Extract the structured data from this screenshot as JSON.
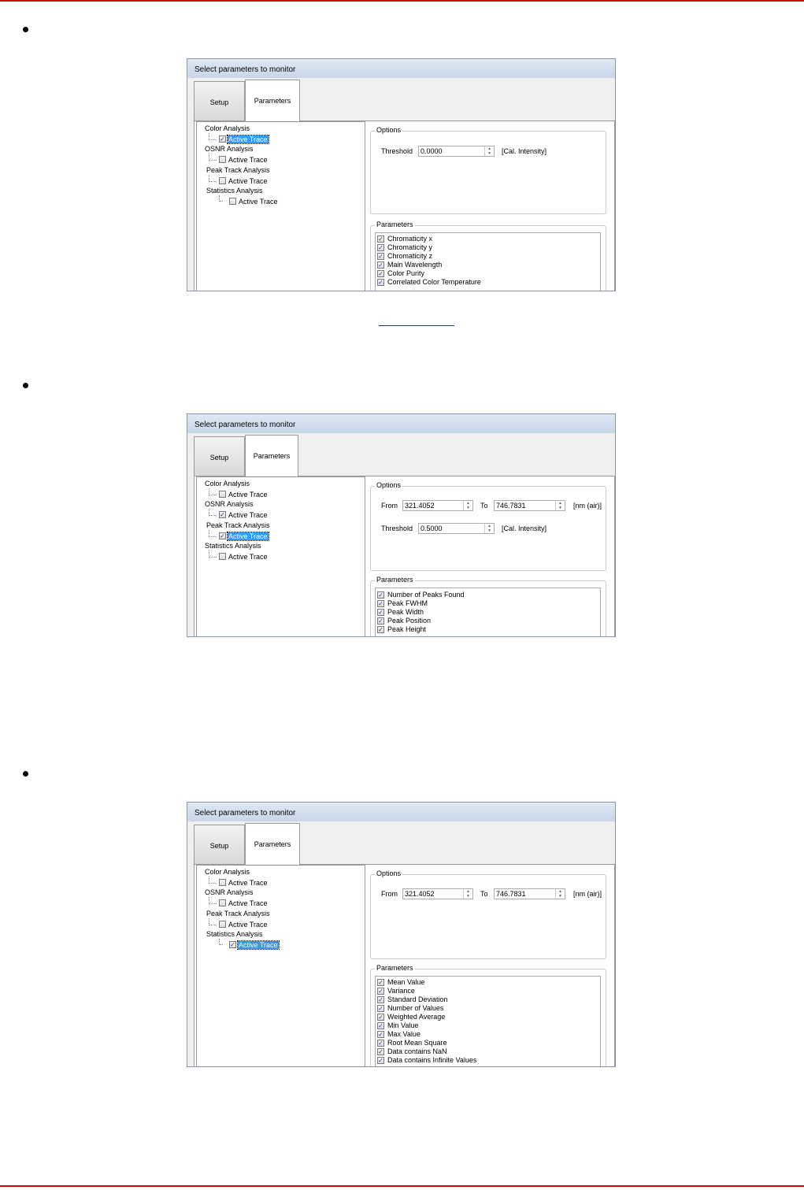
{
  "dialogs": [
    {
      "title": "Select parameters to monitor",
      "tabs": [
        "Setup",
        "Parameters"
      ],
      "tree": [
        {
          "label": "Color Analysis",
          "child": "Active Trace",
          "checked": true,
          "selected": true
        },
        {
          "label": "OSNR Analysis",
          "child": "Active Trace",
          "checked": false,
          "selected": false
        },
        {
          "label": "Peak Track Analysis",
          "child": "Active Trace",
          "checked": false,
          "selected": false
        },
        {
          "label": "Statistics Analysis",
          "child": "Active Trace",
          "checked": false,
          "selected": false
        }
      ],
      "options_title": "Options",
      "threshold": {
        "label": "Threshold",
        "value": "0.0000",
        "unit": "[Cal. Intensity]"
      },
      "parameters_title": "Parameters",
      "parameters": [
        "Chromaticity x",
        "Chromaticity y",
        "Chromaticity z",
        "Main Wavelength",
        "Color Purity",
        "Correlated Color Temperature"
      ]
    },
    {
      "title": "Select parameters to monitor",
      "tabs": [
        "Setup",
        "Parameters"
      ],
      "tree": [
        {
          "label": "Color Analysis",
          "child": "Active Trace",
          "checked": false,
          "selected": false
        },
        {
          "label": "OSNR Analysis",
          "child": "Active Trace",
          "checked": true,
          "selected": false
        },
        {
          "label": "Peak Track Analysis",
          "child": "Active Trace",
          "checked": true,
          "selected": true
        },
        {
          "label": "Statistics Analysis",
          "child": "Active Trace",
          "checked": false,
          "selected": false
        }
      ],
      "options_title": "Options",
      "range": {
        "from_label": "From",
        "from_value": "321.4052",
        "to_label": "To",
        "to_value": "746.7831",
        "unit": "[nm (air)]"
      },
      "threshold": {
        "label": "Threshold",
        "value": "0.5000",
        "unit": "[Cal. Intensity]"
      },
      "parameters_title": "Parameters",
      "parameters": [
        "Number of Peaks Found",
        "Peak FWHM",
        "Peak Width",
        "Peak Position",
        "Peak Height"
      ]
    },
    {
      "title": "Select parameters to monitor",
      "tabs": [
        "Setup",
        "Parameters"
      ],
      "tree": [
        {
          "label": "Color Analysis",
          "child": "Active Trace",
          "checked": false,
          "selected": false
        },
        {
          "label": "OSNR Analysis",
          "child": "Active Trace",
          "checked": false,
          "selected": false
        },
        {
          "label": "Peak Track Analysis",
          "child": "Active Trace",
          "checked": false,
          "selected": false
        },
        {
          "label": "Statistics Analysis",
          "child": "Active Trace",
          "checked": true,
          "selected": true
        }
      ],
      "options_title": "Options",
      "range": {
        "from_label": "From",
        "from_value": "321.4052",
        "to_label": "To",
        "to_value": "746.7831",
        "unit": "[nm (air)]"
      },
      "parameters_title": "Parameters",
      "parameters": [
        "Mean Value",
        "Variance",
        "Standard Deviation",
        "Number of Values",
        "Weighted Average",
        "Min Value",
        "Max Value",
        "Root Mean Square",
        "Data contains NaN",
        "Data contains Infinite Values"
      ]
    }
  ]
}
